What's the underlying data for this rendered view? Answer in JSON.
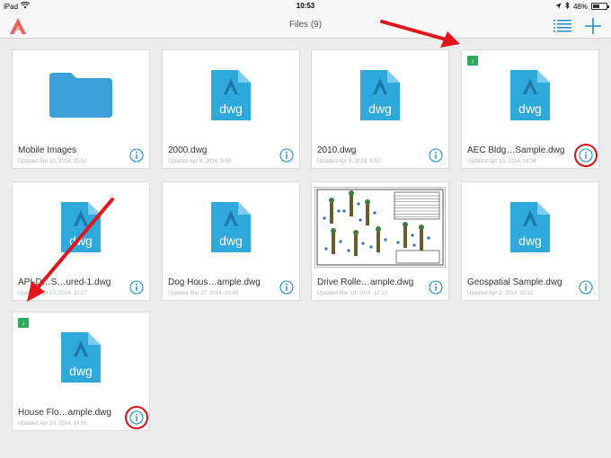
{
  "status": {
    "device": "iPad",
    "time": "10:53",
    "battery": "48%"
  },
  "nav": {
    "title": "Files (9)"
  },
  "files": [
    {
      "name": "Mobile Images",
      "updated": "Updated Apr 10, 2014, 15:51",
      "kind": "folder",
      "downloaded": false,
      "highlight": false
    },
    {
      "name": "2000.dwg",
      "updated": "Updated Apr 9, 2014, 9:56",
      "kind": "dwg",
      "downloaded": false,
      "highlight": false
    },
    {
      "name": "2010.dwg",
      "updated": "Updated Apr 9, 2014, 9:57",
      "kind": "dwg",
      "downloaded": false,
      "highlight": false
    },
    {
      "name": "AEC Bldg…Sample.dwg",
      "updated": "Updated Apr 10, 2014, 14:36",
      "kind": "dwg",
      "downloaded": true,
      "highlight": true
    },
    {
      "name": "API-D…S…ured-1.dwg",
      "updated": "Updated Apr 10, 2014, 15:27",
      "kind": "dwg",
      "downloaded": false,
      "highlight": false
    },
    {
      "name": "Dog Hous…ample.dwg",
      "updated": "Updated Mar 27, 2014, 15:45",
      "kind": "dwg",
      "downloaded": false,
      "highlight": false
    },
    {
      "name": "Drive Rolle…ample.dwg",
      "updated": "Updated Mar 10, 2014, 12:12",
      "kind": "drawing",
      "downloaded": false,
      "highlight": false
    },
    {
      "name": "Geospatial Sample.dwg",
      "updated": "Updated Apr 2, 2014, 15:22",
      "kind": "dwg",
      "downloaded": false,
      "highlight": false
    },
    {
      "name": "House Flo…ample.dwg",
      "updated": "Updated Apr 10, 2014, 14:06",
      "kind": "dwg",
      "downloaded": true,
      "highlight": true
    }
  ],
  "dwg_label": "dwg",
  "colors": {
    "accent": "#1a8fcb",
    "file_icon": "#2fa8dc",
    "folder": "#3b9fd8",
    "download_badge": "#2eaa5c",
    "annotation": "#d9121b"
  }
}
